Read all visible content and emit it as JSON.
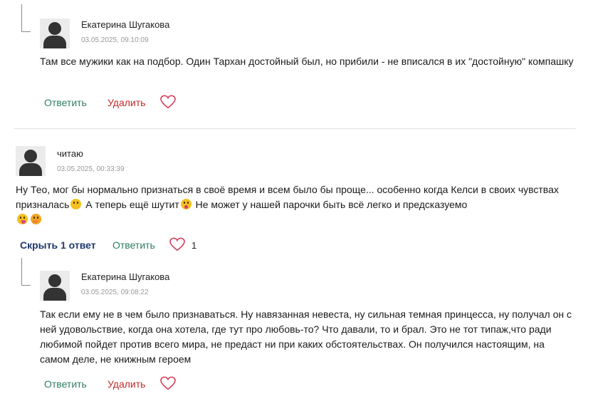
{
  "comments": [
    {
      "author": "Екатерина Шугакова",
      "date": "03.05.2025, 09:10:09",
      "text": "Там все мужики как на подбор. Один Тархан достойный был, но прибили - не вписался в их \"достойную\" компашку",
      "reply_label": "Ответить",
      "delete_label": "Удалить"
    },
    {
      "author": "читаю",
      "date": "03.05.2025, 00:33:39",
      "text_part1": "Ну Тео, мог бы нормально признаться в своё время и всем было бы проще... особенно когда Келси в своих чувствах призналась",
      "text_part2": " А теперь ещё шутит",
      "text_part3": " Не может у нашей парочки быть всё легко и предсказуемо",
      "hide_label": "Скрыть 1 ответ",
      "reply_label": "Ответить",
      "likes": "1"
    },
    {
      "author": "Екатерина Шугакова",
      "date": "03.05.2025, 09:08:22",
      "text": "Так если ему не в чем было признаваться. Ну навязанная невеста, ну сильная темная принцесса, ну получал он с ней удовольствие, когда она хотела, где тут про любовь-то? Что давали, то и брал. Это не тот типаж,что ради любимой пойдет против всего мира, не предаст ни при каких обстоятельствах. Он получился настоящим, на самом деле, не книжным героем",
      "reply_label": "Ответить",
      "delete_label": "Удалить"
    }
  ],
  "icons": {
    "avatar": "user-silhouette-icon",
    "heart": "heart-outline-icon",
    "emoji_1": "thinking-face-icon",
    "emoji_2": "crazy-face-icon",
    "emoji_3": "tongue-face-icon",
    "emoji_4": "giggle-face-icon"
  },
  "colors": {
    "reply": "#2e7d62",
    "delete": "#c62828",
    "hide": "#1e3a6e",
    "heart": "#d6405a"
  }
}
